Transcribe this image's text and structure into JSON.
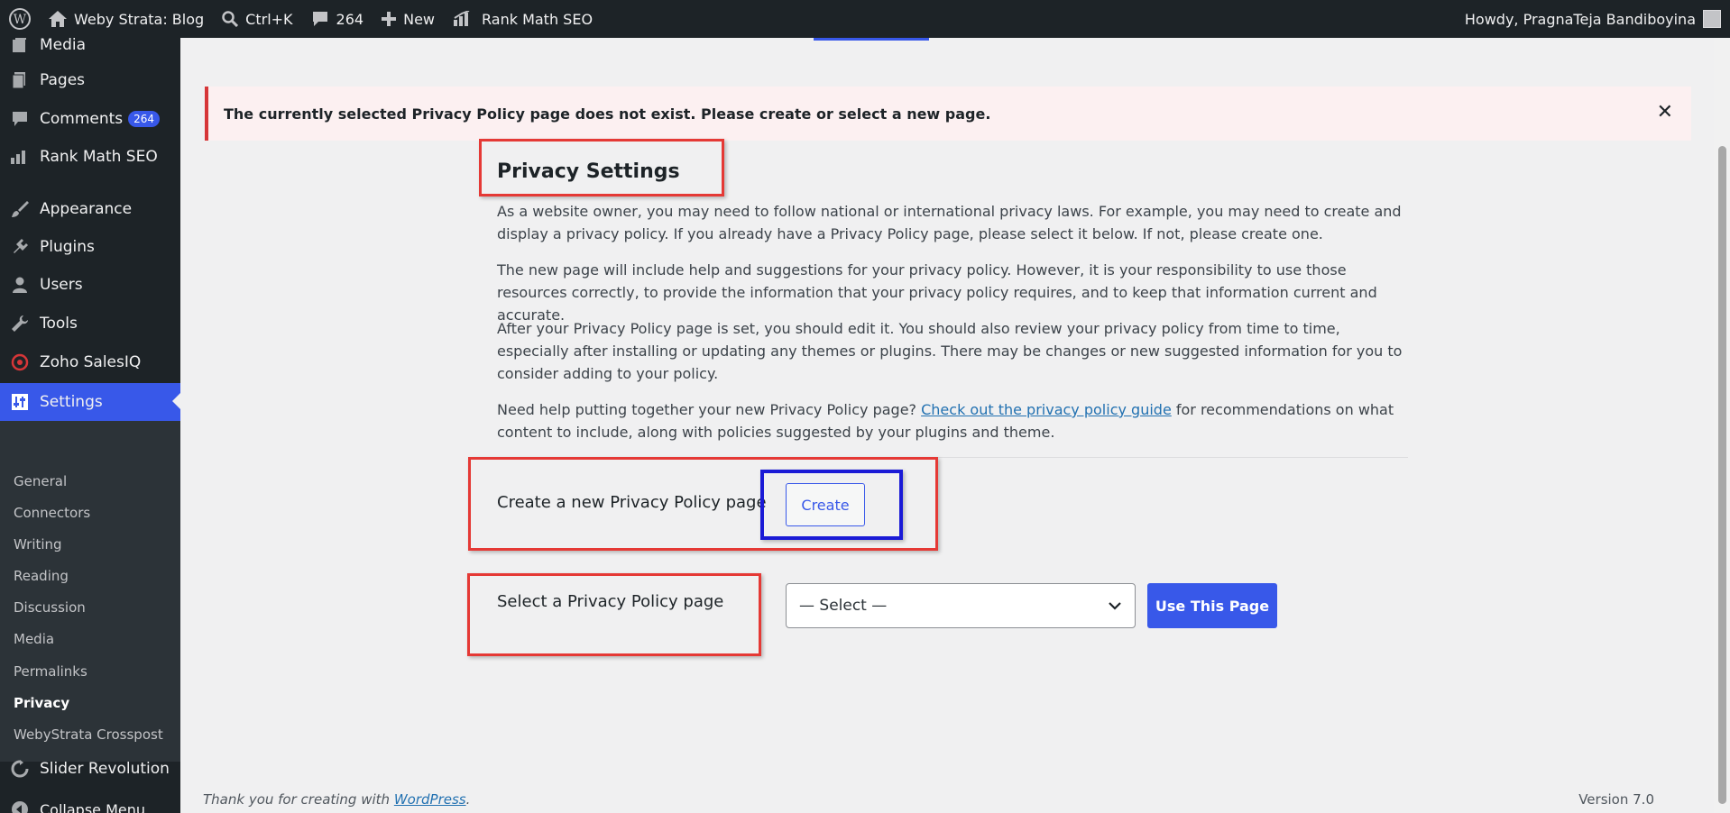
{
  "admin_bar": {
    "site_name": "Weby Strata: Blog",
    "search_shortcut": "Ctrl+K",
    "comments_count": "264",
    "new_label": "New",
    "seo_label": "Rank Math SEO",
    "howdy": "Howdy, PragnaTeja Bandiboyina"
  },
  "sidebar": {
    "items": [
      {
        "label": "Media",
        "icon": "media-icon"
      },
      {
        "label": "Pages",
        "icon": "pages-icon"
      },
      {
        "label": "Comments",
        "icon": "comments-icon",
        "badge": "264"
      },
      {
        "label": "Rank Math SEO",
        "icon": "rankmath-icon"
      },
      {
        "label": "Appearance",
        "icon": "appearance-icon"
      },
      {
        "label": "Plugins",
        "icon": "plugins-icon"
      },
      {
        "label": "Users",
        "icon": "users-icon"
      },
      {
        "label": "Tools",
        "icon": "tools-icon"
      },
      {
        "label": "Zoho SalesIQ",
        "icon": "zoho-icon"
      },
      {
        "label": "Settings",
        "icon": "settings-icon"
      },
      {
        "label": "Slider Revolution",
        "icon": "slider-icon"
      },
      {
        "label": "Collapse Menu",
        "icon": "collapse-icon"
      }
    ],
    "submenu": [
      "General",
      "Connectors",
      "Writing",
      "Reading",
      "Discussion",
      "Media",
      "Permalinks",
      "Privacy",
      "WebyStrata Crosspost"
    ]
  },
  "notice": {
    "text": "The currently selected Privacy Policy page does not exist. Please create or select a new page."
  },
  "main": {
    "title": "Privacy Settings",
    "para1": "As a website owner, you may need to follow national or international privacy laws. For example, you may need to create and display a privacy policy. If you already have a Privacy Policy page, please select it below. If not, please create one.",
    "para2": "The new page will include help and suggestions for your privacy policy. However, it is your responsibility to use those resources correctly, to provide the information that your privacy policy requires, and to keep that information current and accurate.",
    "para3": "After your Privacy Policy page is set, you should edit it. You should also review your privacy policy from time to time, especially after installing or updating any themes or plugins. There may be changes or new suggested information for you to consider adding to your policy.",
    "para4_before": "Need help putting together your new Privacy Policy page? ",
    "para4_link": "Check out the privacy policy guide",
    "para4_after": " for recommendations on what content to include, along with policies suggested by your plugins and theme.",
    "create_label": "Create a new Privacy Policy page",
    "create_button": "Create",
    "select_label": "Select a Privacy Policy page",
    "select_value": "— Select —",
    "use_button": "Use This Page"
  },
  "footer": {
    "thanks_before": "Thank you for creating with ",
    "thanks_link": "WordPress",
    "thanks_after": ".",
    "version": "Version 7.0"
  },
  "colors": {
    "accent": "#3858e9",
    "admin_bar": "#1d2327",
    "notice_border": "#d63638",
    "annotation_red": "#e53935",
    "annotation_blue": "#1a1ad6"
  }
}
